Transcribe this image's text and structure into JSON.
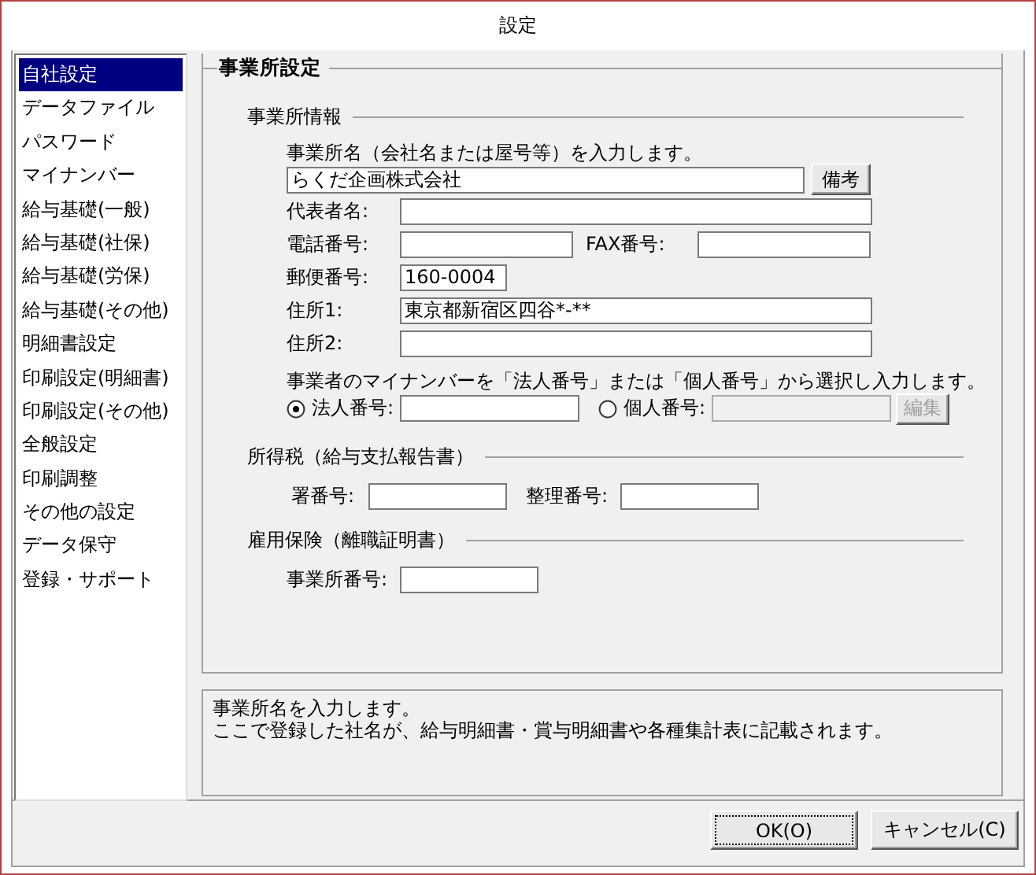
{
  "window": {
    "title": "設定"
  },
  "sidebar": {
    "items": [
      {
        "label": "自社設定",
        "selected": true
      },
      {
        "label": "データファイル",
        "selected": false
      },
      {
        "label": "パスワード",
        "selected": false
      },
      {
        "label": "マイナンバー",
        "selected": false
      },
      {
        "label": "給与基礎(一般)",
        "selected": false
      },
      {
        "label": "給与基礎(社保)",
        "selected": false
      },
      {
        "label": "給与基礎(労保)",
        "selected": false
      },
      {
        "label": "給与基礎(その他)",
        "selected": false
      },
      {
        "label": "明細書設定",
        "selected": false
      },
      {
        "label": "印刷設定(明細書)",
        "selected": false
      },
      {
        "label": "印刷設定(その他)",
        "selected": false
      },
      {
        "label": "全般設定",
        "selected": false
      },
      {
        "label": "印刷調整",
        "selected": false
      },
      {
        "label": "その他の設定",
        "selected": false
      },
      {
        "label": "データ保守",
        "selected": false
      },
      {
        "label": "登録・サポート",
        "selected": false
      }
    ]
  },
  "panel": {
    "title": "事業所設定"
  },
  "office_info": {
    "heading": "事業所情報",
    "name_prompt": "事業所名（会社名または屋号等）を入力します。",
    "name_field": {
      "value": "らくだ企画株式会社"
    },
    "note_button": "備考",
    "representative": {
      "label": "代表者名:"
    },
    "phone": {
      "label": "電話番号:"
    },
    "fax": {
      "label": "FAX番号:"
    },
    "postal": {
      "label": "郵便番号:",
      "value": "160-0004"
    },
    "address1": {
      "label": "住所1:",
      "value": "東京都新宿区四谷*-**"
    },
    "address2": {
      "label": "住所2:"
    },
    "mynumber_prompt": "事業者のマイナンバーを「法人番号」または「個人番号」から選択し入力します。",
    "number_options": [
      {
        "label": "法人番号:",
        "selected": true
      },
      {
        "label": "個人番号:",
        "selected": false
      }
    ],
    "edit_button": {
      "label": "編集",
      "disabled": true
    }
  },
  "income_tax": {
    "heading": "所得税（給与支払報告書）",
    "fields": [
      {
        "label": "署番号:"
      },
      {
        "label": "整理番号:"
      }
    ]
  },
  "employment_insurance": {
    "heading": "雇用保険（離職証明書）",
    "fields": [
      {
        "label": "事業所番号:"
      }
    ]
  },
  "description": [
    "事業所名を入力します。",
    "ここで登録した社名が、給与明細書・賞与明細書や各種集計表に記載されます。"
  ],
  "buttons": [
    {
      "label": "OK(O)",
      "focused": true
    },
    {
      "label": "キャンセル(C)",
      "focused": false
    }
  ]
}
